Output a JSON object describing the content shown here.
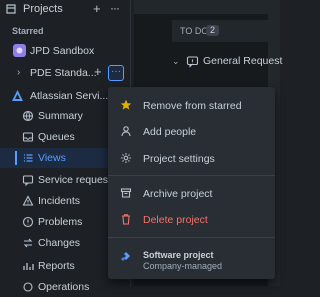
{
  "sidebar": {
    "header": {
      "title": "Projects"
    },
    "starred_label": "Starred",
    "starred": [
      {
        "label": "JPD Sandbox",
        "avatar_color": "#8f7ee7"
      },
      {
        "label": "PDE Standa...",
        "avatar_color": "#e2b203"
      }
    ],
    "project": {
      "label": "Atlassian Servi...",
      "avatar_color": "#579dff"
    },
    "nav": [
      {
        "label": "Summary",
        "icon": "globe-icon"
      },
      {
        "label": "Queues",
        "icon": "inbox-icon"
      },
      {
        "label": "Views",
        "icon": "list-icon",
        "active": true
      },
      {
        "label": "Service requests",
        "icon": "request-icon"
      },
      {
        "label": "Incidents",
        "icon": "incident-icon"
      },
      {
        "label": "Problems",
        "icon": "problem-icon"
      },
      {
        "label": "Changes",
        "icon": "changes-icon"
      },
      {
        "label": "Reports",
        "icon": "reports-icon"
      },
      {
        "label": "Operations",
        "icon": "operations-icon"
      }
    ]
  },
  "board": {
    "todo_label": "TO DO",
    "todo_count": "2",
    "group_label": "General Request"
  },
  "menu": {
    "items": [
      {
        "label": "Remove from starred",
        "icon": "star-icon"
      },
      {
        "label": "Add people",
        "icon": "person-icon"
      },
      {
        "label": "Project settings",
        "icon": "gear-icon"
      },
      {
        "label": "Archive project",
        "icon": "archive-icon"
      },
      {
        "label": "Delete project",
        "icon": "trash-icon"
      }
    ],
    "footer": {
      "title": "Software project",
      "subtitle": "Company-managed"
    }
  },
  "colors": {
    "accent": "#579dff",
    "danger": "#f87168",
    "star": "#e2b203"
  }
}
